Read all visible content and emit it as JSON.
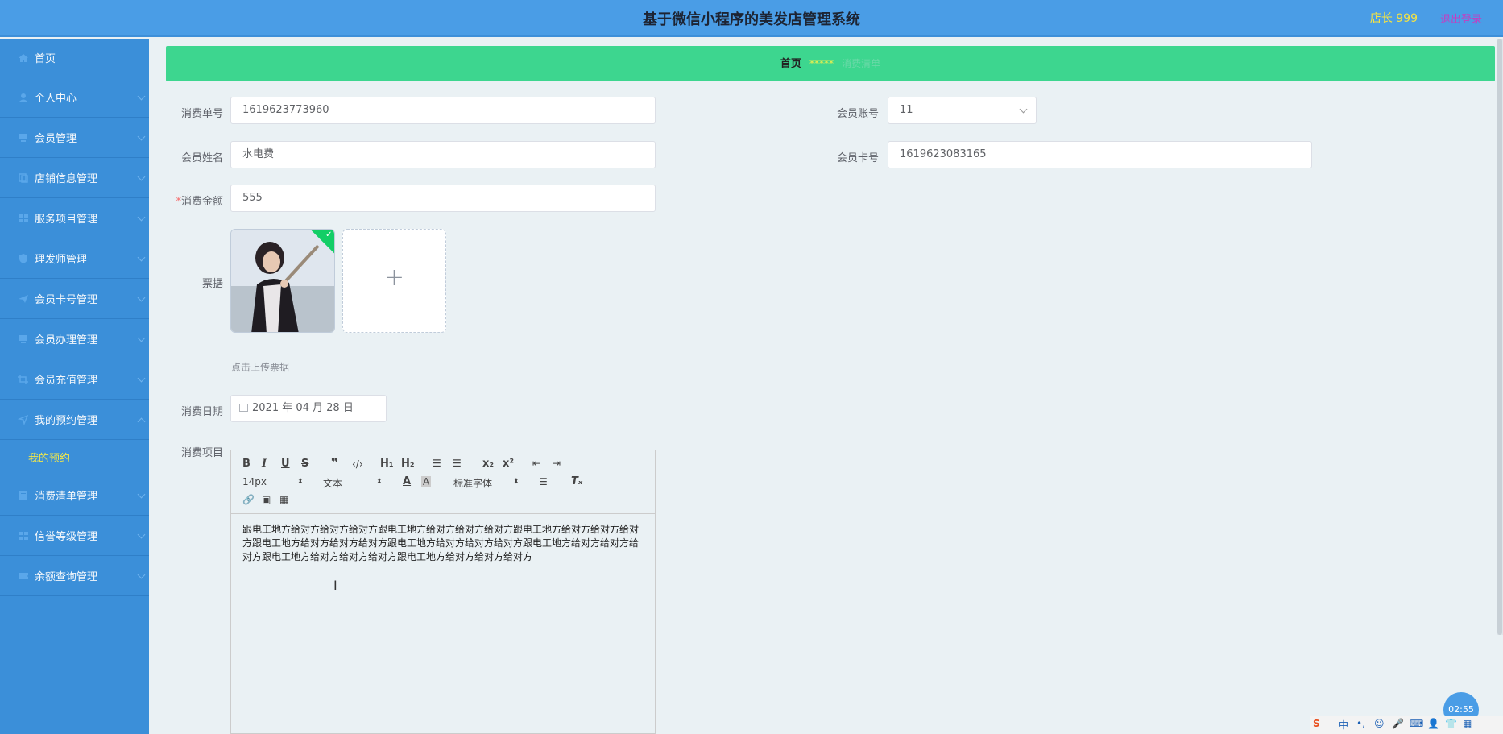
{
  "header": {
    "title": "基于微信小程序的美发店管理系统",
    "user": "店长 999",
    "logout": "退出登录"
  },
  "sidebar": {
    "items": [
      {
        "label": "首页",
        "icon": "home-icon"
      },
      {
        "label": "个人中心",
        "icon": "user-icon"
      },
      {
        "label": "会员管理",
        "icon": "monitor-icon"
      },
      {
        "label": "店铺信息管理",
        "icon": "copy-icon"
      },
      {
        "label": "服务项目管理",
        "icon": "grid-icon"
      },
      {
        "label": "理发师管理",
        "icon": "shield-icon"
      },
      {
        "label": "会员卡号管理",
        "icon": "send-icon"
      },
      {
        "label": "会员办理管理",
        "icon": "monitor-icon"
      },
      {
        "label": "会员充值管理",
        "icon": "crop-icon"
      },
      {
        "label": "我的预约管理",
        "icon": "location-icon"
      },
      {
        "label": "消费清单管理",
        "icon": "list-icon"
      },
      {
        "label": "信誉等级管理",
        "icon": "grid-icon"
      },
      {
        "label": "余额查询管理",
        "icon": "ticket-icon"
      }
    ],
    "sub_item": "我的预约"
  },
  "breadcrumb": {
    "home": "首页",
    "separator": "*****",
    "current": "消费清单"
  },
  "form": {
    "order_no_label": "消费单号",
    "order_no": "1619623773960",
    "member_account_label": "会员账号",
    "member_account": "11",
    "member_name_label": "会员姓名",
    "member_name": "水电费",
    "member_card_label": "会员卡号",
    "member_card": "1619623083165",
    "amount_required": "*",
    "amount_label": "消费金额",
    "amount": "555",
    "receipt_label": "票据",
    "upload_hint": "点击上传票据",
    "date_label": "消费日期",
    "date": "2021 年 04 月 28 日",
    "items_label": "消费项目"
  },
  "editor": {
    "font_size": "14px",
    "text_style": "文本",
    "font_family": "标准字体",
    "content": "跟电工地方给对方给对方给对方跟电工地方给对方给对方给对方跟电工地方给对方给对方给对方跟电工地方给对方给对方给对方跟电工地方给对方给对方给对方跟电工地方给对方给对方给对方跟电工地方给对方给对方给对方跟电工地方给对方给对方给对方"
  },
  "tray": {
    "ime": "中",
    "time": "02:55"
  }
}
